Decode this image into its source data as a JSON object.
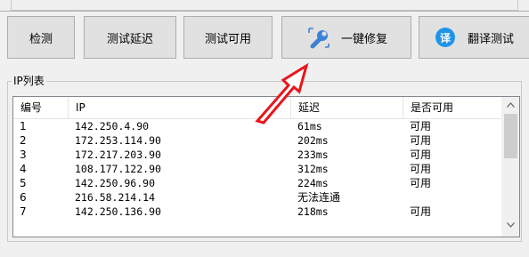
{
  "buttons": {
    "detect": "检测",
    "test_latency": "测试延迟",
    "test_available": "测试可用",
    "one_click_fix": "一键修复",
    "translate_test_badge": "译",
    "translate_test": "翻译测试"
  },
  "ip_group": {
    "title": "IP列表",
    "columns": [
      "编号",
      "IP",
      "延迟",
      "是否可用"
    ],
    "rows": [
      {
        "no": "1",
        "ip": "142.250.4.90",
        "latency": "61ms",
        "available": "可用"
      },
      {
        "no": "2",
        "ip": "172.253.114.90",
        "latency": "202ms",
        "available": "可用"
      },
      {
        "no": "3",
        "ip": "172.217.203.90",
        "latency": "233ms",
        "available": "可用"
      },
      {
        "no": "4",
        "ip": "108.177.122.90",
        "latency": "312ms",
        "available": "可用"
      },
      {
        "no": "5",
        "ip": "142.250.96.90",
        "latency": "224ms",
        "available": "可用"
      },
      {
        "no": "6",
        "ip": "216.58.214.14",
        "latency": "无法连通",
        "available": ""
      },
      {
        "no": "7",
        "ip": "142.250.136.90",
        "latency": "218ms",
        "available": "可用"
      }
    ]
  },
  "colors": {
    "annotation_arrow": "#e8151b",
    "badge_blue": "#1f95e8",
    "wrench_blue": "#4a90d9"
  }
}
